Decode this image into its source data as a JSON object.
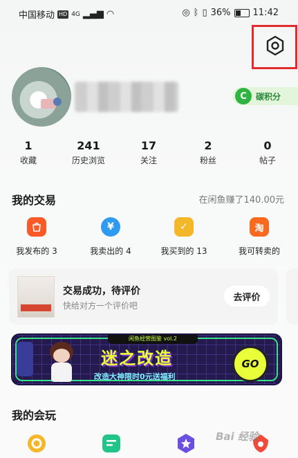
{
  "status_bar": {
    "carrier": "中国移动",
    "hd_badge": "HD",
    "network": "4G",
    "battery_pct": "36%",
    "time": "11:42"
  },
  "profile": {
    "carbon_icon_letter": "C",
    "carbon_label": "碳积分"
  },
  "stats": [
    {
      "num": "1",
      "label": "收藏"
    },
    {
      "num": "241",
      "label": "历史浏览"
    },
    {
      "num": "17",
      "label": "关注"
    },
    {
      "num": "2",
      "label": "粉丝"
    },
    {
      "num": "0",
      "label": "帖子"
    }
  ],
  "trade": {
    "title": "我的交易",
    "earned": "在闲鱼赚了140.00元",
    "items": [
      {
        "label": "我发布的 3",
        "icon": "bag-icon",
        "glyph": "⌂",
        "color": "#fa5a28"
      },
      {
        "label": "我卖出的 4",
        "icon": "yuan-icon",
        "glyph": "¥",
        "color": "#2e9bf0"
      },
      {
        "label": "我买到的 13",
        "icon": "bought-icon",
        "glyph": "✓",
        "color": "#f5b72a"
      },
      {
        "label": "我可转卖的",
        "icon": "tao-icon",
        "glyph": "淘",
        "color": "#fa6a1e"
      }
    ]
  },
  "review": {
    "title": "交易成功，待评价",
    "subtitle": "快给对方一个评价吧",
    "button": "去评价"
  },
  "banner": {
    "tag": "闲鱼经营图鉴 vol.2",
    "title": "迷之改造",
    "subtitle": "改造大神限时0元送福利",
    "go": "GO"
  },
  "play": {
    "title": "我的会玩",
    "items": [
      {
        "icon": "coin-icon",
        "color": "#f5b72a"
      },
      {
        "icon": "note-icon",
        "color": "#22c48a"
      },
      {
        "icon": "star-icon",
        "color": "#6a4fe0"
      },
      {
        "icon": "guitar-icon",
        "color": "#f24a3a"
      }
    ]
  },
  "watermark": "Bai 经验"
}
